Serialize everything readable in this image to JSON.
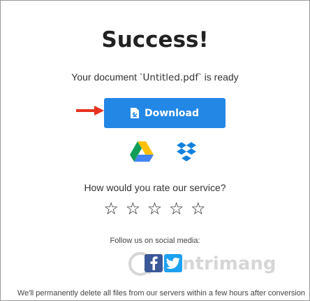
{
  "result": {
    "title": "Success!",
    "status_prefix": "Your document `",
    "filename": "Untitled.pdf",
    "status_suffix": "` is ready"
  },
  "download_button": {
    "label": "Download"
  },
  "save_to": {
    "google_drive_icon": "google-drive-icon",
    "dropbox_icon": "dropbox-icon"
  },
  "rating": {
    "question": "How would you rate our service?",
    "stars": [
      "☆",
      "☆",
      "☆",
      "☆",
      "☆"
    ],
    "selected": 0,
    "max": 5
  },
  "social": {
    "label": "Follow us on social media:",
    "networks": [
      "facebook",
      "twitter"
    ]
  },
  "watermark": {
    "text": "uantrimang"
  },
  "notice": "We'll permanently delete all files from our servers within a few hours after conversion",
  "colors": {
    "accent": "#2387e6",
    "arrow": "#e8321e",
    "facebook": "#3b5998",
    "twitter": "#1da1f2"
  }
}
